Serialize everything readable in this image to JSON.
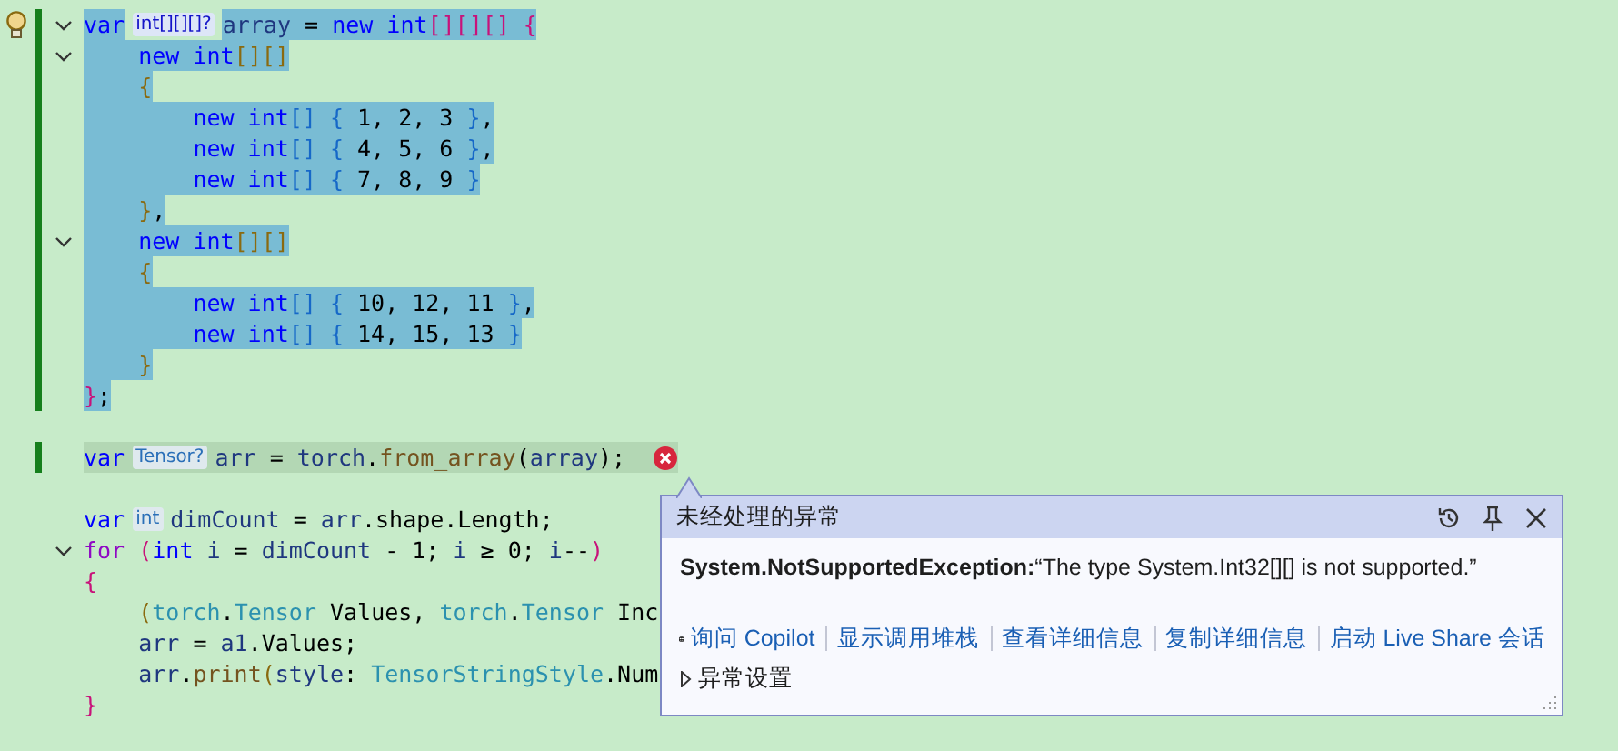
{
  "editor": {
    "lines": [
      {
        "selected": true,
        "changed": true,
        "fold": true,
        "lightbulb": true,
        "segments": [
          {
            "kind": "code",
            "tokens": [
              {
                "kind": "kw",
                "text": "var"
              }
            ]
          },
          {
            "kind": "hint",
            "text": "int[][][]?"
          },
          {
            "kind": "code",
            "tokens": [
              {
                "kind": "id",
                "text": "array"
              },
              {
                "kind": "p",
                "text": " = "
              },
              {
                "kind": "kw",
                "text": "new int"
              },
              {
                "kind": "b1",
                "text": "[][][] {"
              }
            ]
          }
        ]
      },
      {
        "selected": true,
        "changed": true,
        "fold": true,
        "segments": [
          {
            "kind": "code",
            "tokens": [
              {
                "kind": "kw",
                "text": "    new int"
              },
              {
                "kind": "b2",
                "text": "[][]"
              }
            ]
          }
        ]
      },
      {
        "selected": true,
        "changed": true,
        "fold": false,
        "segments": [
          {
            "kind": "code",
            "tokens": [
              {
                "kind": "b2",
                "text": "    {"
              }
            ]
          }
        ]
      },
      {
        "selected": true,
        "changed": true,
        "fold": false,
        "segments": [
          {
            "kind": "code",
            "tokens": [
              {
                "kind": "kw",
                "text": "        new int"
              },
              {
                "kind": "b3",
                "text": "[] {"
              },
              {
                "kind": "num",
                "text": " 1, 2, 3 "
              },
              {
                "kind": "b3",
                "text": "}"
              },
              {
                "kind": "p",
                "text": ","
              }
            ]
          }
        ]
      },
      {
        "selected": true,
        "changed": true,
        "fold": false,
        "segments": [
          {
            "kind": "code",
            "tokens": [
              {
                "kind": "kw",
                "text": "        new int"
              },
              {
                "kind": "b3",
                "text": "[] {"
              },
              {
                "kind": "num",
                "text": " 4, 5, 6 "
              },
              {
                "kind": "b3",
                "text": "}"
              },
              {
                "kind": "p",
                "text": ","
              }
            ]
          }
        ]
      },
      {
        "selected": true,
        "changed": true,
        "fold": false,
        "segments": [
          {
            "kind": "code",
            "tokens": [
              {
                "kind": "kw",
                "text": "        new int"
              },
              {
                "kind": "b3",
                "text": "[] {"
              },
              {
                "kind": "num",
                "text": " 7, 8, 9 "
              },
              {
                "kind": "b3",
                "text": "}"
              }
            ]
          }
        ]
      },
      {
        "selected": true,
        "changed": true,
        "fold": false,
        "segments": [
          {
            "kind": "code",
            "tokens": [
              {
                "kind": "b2",
                "text": "    }"
              },
              {
                "kind": "p",
                "text": ","
              }
            ]
          }
        ]
      },
      {
        "selected": true,
        "changed": true,
        "fold": true,
        "segments": [
          {
            "kind": "code",
            "tokens": [
              {
                "kind": "kw",
                "text": "    new int"
              },
              {
                "kind": "b2",
                "text": "[][]"
              }
            ]
          }
        ]
      },
      {
        "selected": true,
        "changed": true,
        "fold": false,
        "segments": [
          {
            "kind": "code",
            "tokens": [
              {
                "kind": "b2",
                "text": "    {"
              }
            ]
          }
        ]
      },
      {
        "selected": true,
        "changed": true,
        "fold": false,
        "segments": [
          {
            "kind": "code",
            "tokens": [
              {
                "kind": "kw",
                "text": "        new int"
              },
              {
                "kind": "b3",
                "text": "[] {"
              },
              {
                "kind": "num",
                "text": " 10, 12, 11 "
              },
              {
                "kind": "b3",
                "text": "}"
              },
              {
                "kind": "p",
                "text": ","
              }
            ]
          }
        ]
      },
      {
        "selected": true,
        "changed": true,
        "fold": false,
        "segments": [
          {
            "kind": "code",
            "tokens": [
              {
                "kind": "kw",
                "text": "        new int"
              },
              {
                "kind": "b3",
                "text": "[] {"
              },
              {
                "kind": "num",
                "text": " 14, 15, 13 "
              },
              {
                "kind": "b3",
                "text": "}"
              }
            ]
          }
        ]
      },
      {
        "selected": true,
        "changed": true,
        "fold": false,
        "segments": [
          {
            "kind": "code",
            "tokens": [
              {
                "kind": "b2",
                "text": "    }"
              }
            ]
          }
        ]
      },
      {
        "selected": true,
        "changed": true,
        "fold": false,
        "segments": [
          {
            "kind": "code",
            "tokens": [
              {
                "kind": "b1",
                "text": "}"
              },
              {
                "kind": "p",
                "text": ";"
              }
            ]
          }
        ]
      },
      {
        "selected": false,
        "changed": false,
        "fold": false
      },
      {
        "selected": false,
        "changed": true,
        "fold": false,
        "current": true,
        "error": true,
        "segments": [
          {
            "kind": "code",
            "tokens": [
              {
                "kind": "kw",
                "text": "var"
              }
            ]
          },
          {
            "kind": "hint",
            "text": "Tensor?"
          },
          {
            "kind": "code",
            "tokens": [
              {
                "kind": "id",
                "text": "arr"
              },
              {
                "kind": "p",
                "text": " = "
              },
              {
                "kind": "id",
                "text": "torch"
              },
              {
                "kind": "p",
                "text": "."
              },
              {
                "kind": "m",
                "text": "from_array"
              },
              {
                "kind": "p",
                "text": "("
              },
              {
                "kind": "id",
                "text": "array"
              },
              {
                "kind": "p",
                "text": ");"
              }
            ]
          }
        ]
      },
      {
        "selected": false,
        "changed": false,
        "fold": false
      },
      {
        "selected": false,
        "changed": false,
        "fold": false,
        "segments": [
          {
            "kind": "code",
            "tokens": [
              {
                "kind": "kw",
                "text": "var"
              }
            ]
          },
          {
            "kind": "hint",
            "text": "int"
          },
          {
            "kind": "code",
            "tokens": [
              {
                "kind": "id",
                "text": "dimCount"
              },
              {
                "kind": "p",
                "text": " = "
              },
              {
                "kind": "id",
                "text": "arr"
              },
              {
                "kind": "p",
                "text": ".shape.Length;"
              }
            ]
          }
        ]
      },
      {
        "selected": false,
        "changed": false,
        "fold": true,
        "segments": [
          {
            "kind": "code",
            "tokens": [
              {
                "kind": "kw2",
                "text": "for "
              },
              {
                "kind": "b1",
                "text": "("
              },
              {
                "kind": "kw",
                "text": "int"
              },
              {
                "kind": "id",
                "text": " i"
              },
              {
                "kind": "p",
                "text": " = "
              },
              {
                "kind": "id",
                "text": "dimCount"
              },
              {
                "kind": "p",
                "text": " - 1; "
              },
              {
                "kind": "id",
                "text": "i"
              },
              {
                "kind": "p",
                "text": " ≥ 0; "
              },
              {
                "kind": "id",
                "text": "i"
              },
              {
                "kind": "p",
                "text": "--"
              },
              {
                "kind": "b1",
                "text": ")"
              }
            ]
          }
        ]
      },
      {
        "selected": false,
        "changed": false,
        "fold": false,
        "segments": [
          {
            "kind": "code",
            "tokens": [
              {
                "kind": "b1",
                "text": "{"
              }
            ]
          }
        ]
      },
      {
        "selected": false,
        "changed": false,
        "fold": false,
        "segments": [
          {
            "kind": "code",
            "tokens": [
              {
                "kind": "b2",
                "text": "    ("
              },
              {
                "kind": "ty",
                "text": "torch"
              },
              {
                "kind": "p",
                "text": "."
              },
              {
                "kind": "ty",
                "text": "Tensor"
              },
              {
                "kind": "p",
                "text": " Values, "
              },
              {
                "kind": "ty",
                "text": "torch"
              },
              {
                "kind": "p",
                "text": "."
              },
              {
                "kind": "ty",
                "text": "Tensor"
              },
              {
                "kind": "p",
                "text": " Inc"
              }
            ]
          }
        ]
      },
      {
        "selected": false,
        "changed": false,
        "fold": false,
        "segments": [
          {
            "kind": "code",
            "tokens": [
              {
                "kind": "id",
                "text": "    arr"
              },
              {
                "kind": "p",
                "text": " = "
              },
              {
                "kind": "id",
                "text": "a1"
              },
              {
                "kind": "p",
                "text": ".Values;"
              }
            ]
          }
        ]
      },
      {
        "selected": false,
        "changed": false,
        "fold": false,
        "segments": [
          {
            "kind": "code",
            "tokens": [
              {
                "kind": "id",
                "text": "    arr"
              },
              {
                "kind": "p",
                "text": "."
              },
              {
                "kind": "m",
                "text": "print"
              },
              {
                "kind": "b2",
                "text": "("
              },
              {
                "kind": "id",
                "text": "style"
              },
              {
                "kind": "p",
                "text": ": "
              },
              {
                "kind": "ty",
                "text": "TensorStringStyle"
              },
              {
                "kind": "p",
                "text": ".Num"
              }
            ]
          }
        ]
      },
      {
        "selected": false,
        "changed": false,
        "fold": false,
        "segments": [
          {
            "kind": "code",
            "tokens": [
              {
                "kind": "b1",
                "text": "}"
              }
            ]
          }
        ]
      }
    ]
  },
  "exception_popup": {
    "title": "未经处理的异常",
    "exception_type": "System.NotSupportedException:",
    "message": "“The type System.Int32[][] is not supported.”",
    "links": [
      "询问 Copilot",
      "显示调用堆栈",
      "查看详细信息",
      "复制详细信息",
      "启动 Live Share 会话"
    ],
    "settings": {
      "label": "异常设置",
      "expanded": false
    }
  }
}
